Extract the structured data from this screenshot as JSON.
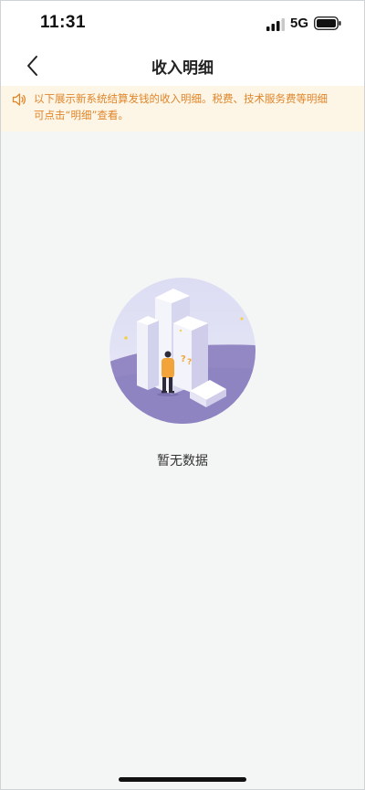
{
  "status_bar": {
    "time": "11:31",
    "network": "5G"
  },
  "nav": {
    "title": "收入明细",
    "back_icon": "chevron-left-icon"
  },
  "notice": {
    "icon": "speaker-icon",
    "line1": "以下展示新系统结算发钱的收入明细。税费、技术服务费等明细",
    "line2": "可点击“明细”查看。",
    "color": "#e0852a",
    "background": "#fdf6e7"
  },
  "empty_state": {
    "text": "暂无数据",
    "illustration": "empty-data-illustration"
  }
}
